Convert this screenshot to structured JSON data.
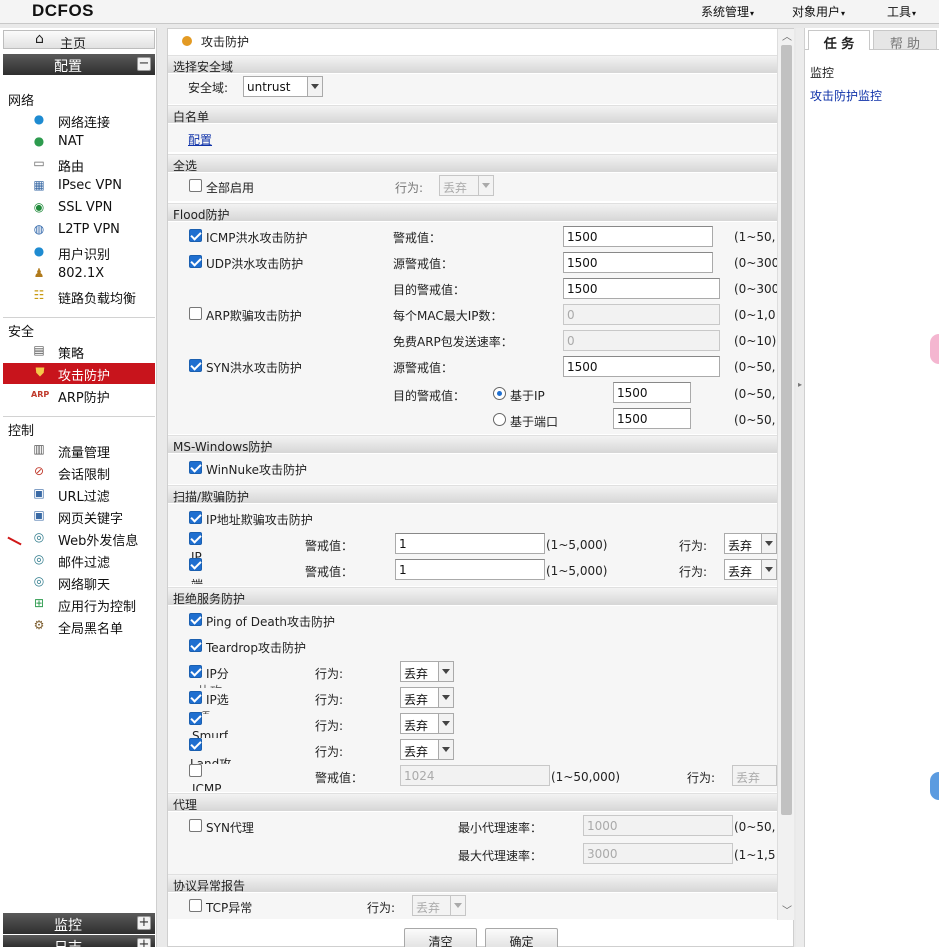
{
  "app": {
    "logo": "DCFOS"
  },
  "topmenu": [
    {
      "label": "系统管理"
    },
    {
      "label": "对象用户"
    },
    {
      "label": "工具"
    }
  ],
  "sidebar": {
    "home": "主页",
    "config": "配置",
    "config_toggle": "−",
    "groups": [
      {
        "title": "网络",
        "items": [
          {
            "label": "网络连接",
            "icon": "globe-icon"
          },
          {
            "label": "NAT",
            "icon": "nat-icon"
          },
          {
            "label": "路由",
            "icon": "router-icon"
          },
          {
            "label": "IPsec VPN",
            "icon": "ipsec-icon"
          },
          {
            "label": "SSL VPN",
            "icon": "ssl-icon"
          },
          {
            "label": "L2TP VPN",
            "icon": "l2tp-icon"
          },
          {
            "label": "用户识别",
            "icon": "user-id-icon"
          },
          {
            "label": "802.1X",
            "icon": "dot1x-icon"
          },
          {
            "label": "链路负载均衡",
            "icon": "load-balance-icon"
          }
        ]
      },
      {
        "title": "安全",
        "items": [
          {
            "label": "策略",
            "icon": "policy-icon"
          },
          {
            "label": "攻击防护",
            "icon": "shield-icon",
            "active": true
          },
          {
            "label": "ARP防护",
            "icon": "arp-icon"
          }
        ]
      },
      {
        "title": "控制",
        "items": [
          {
            "label": "流量管理",
            "icon": "traffic-icon"
          },
          {
            "label": "会话限制",
            "icon": "session-icon"
          },
          {
            "label": "URL过滤",
            "icon": "url-icon"
          },
          {
            "label": "网页关键字",
            "icon": "keyword-icon"
          },
          {
            "label": "Web外发信息",
            "icon": "web-post-icon"
          },
          {
            "label": "邮件过滤",
            "icon": "mail-icon"
          },
          {
            "label": "网络聊天",
            "icon": "chat-icon"
          },
          {
            "label": "应用行为控制",
            "icon": "app-control-icon"
          },
          {
            "label": "全局黑名单",
            "icon": "blacklist-icon"
          }
        ]
      }
    ],
    "monitor": "监控",
    "monitor_toggle": "+",
    "log": "日志",
    "log_toggle": "+"
  },
  "breadcrumb": "攻击防护",
  "zone": {
    "section": "选择安全域",
    "label": "安全域:",
    "value": "untrust"
  },
  "whitelist": {
    "section": "白名单",
    "link": "配置"
  },
  "select_all": {
    "section": "全选",
    "checkbox": "全部启用",
    "action_label": "行为:",
    "action_value": "丢弃"
  },
  "flood": {
    "section": "Flood防护",
    "icmp": {
      "label": "ICMP洪水攻击防护",
      "thr_label": "警戒值：",
      "value": "1500",
      "range": "(1~50,"
    },
    "udp": {
      "label": "UDP洪水攻击防护",
      "src_label": "源警戒值：",
      "src_value": "1500",
      "src_range": "(0~300",
      "dst_label": "目的警戒值：",
      "dst_value": "1500",
      "dst_range": "(0~300"
    },
    "arp": {
      "label": "ARP欺骗攻击防护",
      "mac_label": "每个MAC最大IP数：",
      "mac_value": "0",
      "mac_range": "(0~1,0",
      "rate_label": "免费ARP包发送速率：",
      "rate_value": "0",
      "rate_range": "(0~10)"
    },
    "syn": {
      "label": "SYN洪水攻击防护",
      "src_label": "源警戒值：",
      "src_value": "1500",
      "src_range": "(0~50,",
      "dst_label": "目的警戒值：",
      "opt_ip": "基于IP",
      "opt_ip_value": "1500",
      "opt_ip_range": "(0~50,",
      "opt_port": "基于端口",
      "opt_port_value": "1500",
      "opt_port_range": "(0~50,"
    }
  },
  "mswin": {
    "section": "MS-Windows防护",
    "winnuke": "WinNuke攻击防护"
  },
  "scan": {
    "section": "扫描/欺骗防护",
    "ipspoof": "IP地址欺骗攻击防护",
    "row1": {
      "cut": "IP",
      "thr_label": "警戒值：",
      "value": "1",
      "range": "(1~5,000)",
      "action_label": "行为:",
      "action_value": "丢弃"
    },
    "row2": {
      "cut": "端",
      "thr_label": "警戒值：",
      "value": "1",
      "range": "(1~5,000)",
      "action_label": "行为:",
      "action_value": "丢弃"
    }
  },
  "dos": {
    "section": "拒绝服务防护",
    "pod": "Ping of Death攻击防护",
    "teardrop": "Teardrop攻击防护",
    "rows": [
      {
        "cut": "IP分",
        "cut2": "片攻",
        "action_label": "行为:",
        "action_value": "丢弃"
      },
      {
        "cut": "IP选",
        "cut2": "项",
        "action_label": "行为:",
        "action_value": "丢弃"
      },
      {
        "cut": "",
        "cut2": "Smurf",
        "action_label": "行为:",
        "action_value": "丢弃"
      },
      {
        "cut": "",
        "cut2": "Land攻",
        "action_label": "行为:",
        "action_value": "丢弃"
      }
    ],
    "icmp_big": {
      "cut": "ICMP",
      "thr_label": "警戒值：",
      "value": "1024",
      "range": "(1~50,000)",
      "action_label": "行为:",
      "action_value": "丢弃"
    }
  },
  "proxy": {
    "section": "代理",
    "syn": "SYN代理",
    "min_label": "最小代理速率：",
    "min_value": "1000",
    "min_range": "(0~50,",
    "max_label": "最大代理速率：",
    "max_value": "3000",
    "max_range": "(1~1,5"
  },
  "proto": {
    "section": "协议异常报告",
    "tcp": "TCP异常",
    "action_label": "行为:",
    "action_value": "丢弃"
  },
  "buttons": {
    "clear": "清空",
    "ok": "确定"
  },
  "right_panel": {
    "tab_task": "任 务",
    "tab_help": "帮 助",
    "heading": "监控",
    "link": "攻击防护监控"
  },
  "colors": {
    "active_nav": "#c8141c",
    "accent_dot": "#e39a23",
    "link": "#1033a9",
    "checkbox_on": "#1f6fd0"
  }
}
